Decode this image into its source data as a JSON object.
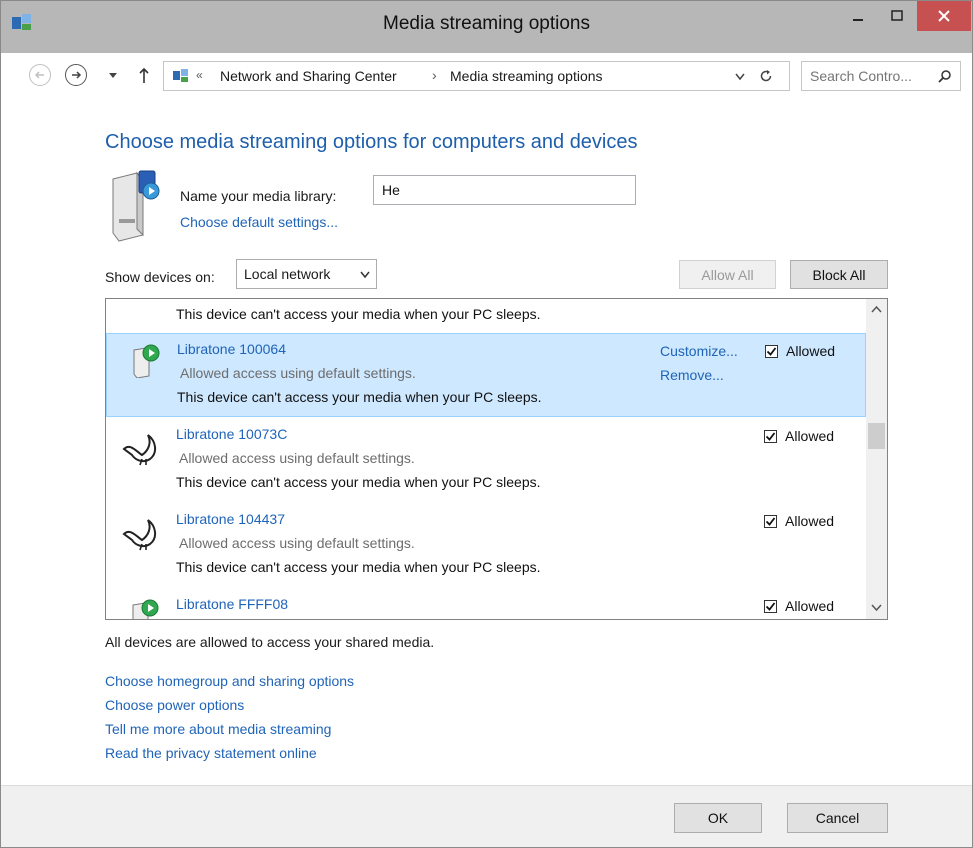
{
  "window": {
    "title": "Media streaming options"
  },
  "nav": {
    "breadcrumb_prefix": "«",
    "breadcrumb_parent": "Network and Sharing Center",
    "breadcrumb_sep": "›",
    "breadcrumb_current": "Media streaming options",
    "search_placeholder": "Search Contro..."
  },
  "main": {
    "heading": "Choose media streaming options for computers and devices",
    "library_label": "Name your media library:",
    "library_value": "He",
    "default_settings_link": "Choose default settings...",
    "show_devices_label": "Show devices on:",
    "show_devices_value": "Local network",
    "allow_all": "Allow All",
    "block_all": "Block All",
    "summary": "All devices are allowed to access your shared media."
  },
  "devices": {
    "top_partial_text": "This device can't access your media when your PC sleeps.",
    "items": [
      {
        "name": "Libratone 100064",
        "status": "Allowed access using default settings.",
        "sleep": "This device can't access your media when your PC sleeps.",
        "allowed": "Allowed",
        "customize": "Customize...",
        "remove": "Remove...",
        "icon": "speaker-play-icon",
        "selected": true
      },
      {
        "name": "Libratone 10073C",
        "status": "Allowed access using default settings.",
        "sleep": "This device can't access your media when your PC sleeps.",
        "allowed": "Allowed",
        "icon": "bird-icon"
      },
      {
        "name": "Libratone 104437",
        "status": "Allowed access using default settings.",
        "sleep": "This device can't access your media when your PC sleeps.",
        "allowed": "Allowed",
        "icon": "bird-icon"
      },
      {
        "name": "Libratone FFFF08",
        "allowed": "Allowed",
        "icon": "speaker-play-icon"
      }
    ]
  },
  "links": {
    "homegroup": "Choose homegroup and sharing options",
    "power": "Choose power options",
    "tell_more": "Tell me more about media streaming",
    "privacy": "Read the privacy statement online"
  },
  "footer": {
    "ok": "OK",
    "cancel": "Cancel"
  },
  "colors": {
    "link": "#1f64b8",
    "heading": "#1e5fab",
    "selection": "#cde8ff",
    "close": "#c75050",
    "titlebar": "#b7b7b7"
  }
}
